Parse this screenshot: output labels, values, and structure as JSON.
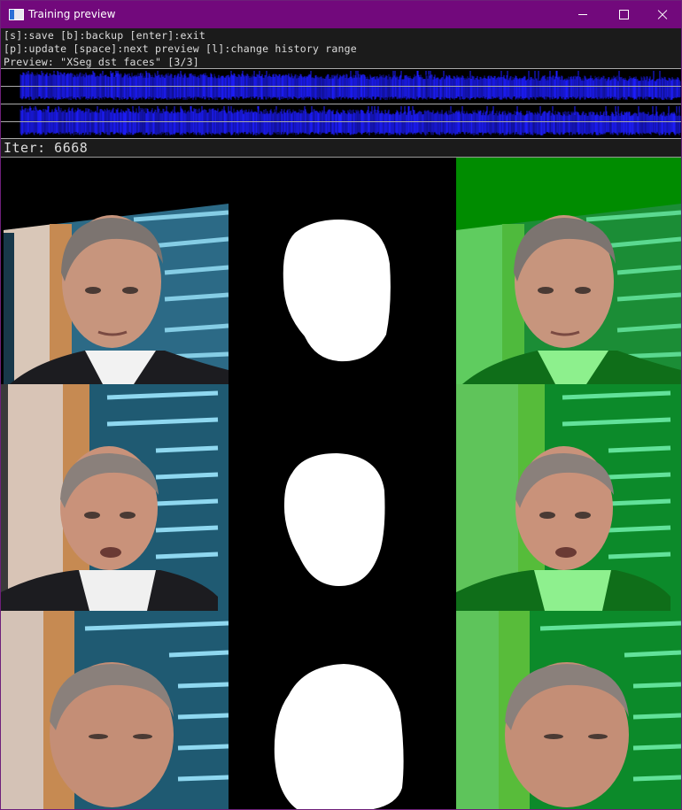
{
  "window": {
    "title": "Training preview",
    "title_bar_color": "#72097c",
    "controls": [
      "minimize-icon",
      "maximize-icon",
      "close-icon"
    ]
  },
  "info": {
    "line1": "[s]:save [b]:backup [enter]:exit",
    "line2": "[p]:update [space]:next preview [l]:change history range",
    "line3": "Preview: \"XSeg dst faces\" [3/3]"
  },
  "history": {
    "graph_color": "#1d1dff",
    "gridline_color": "#aaaaaa"
  },
  "iter": {
    "label": "Iter: 6668"
  },
  "preview": {
    "columns": [
      "dst-face",
      "predicted-mask",
      "mask-overlay"
    ],
    "rows": 3,
    "overlay_color": "#00b400"
  }
}
